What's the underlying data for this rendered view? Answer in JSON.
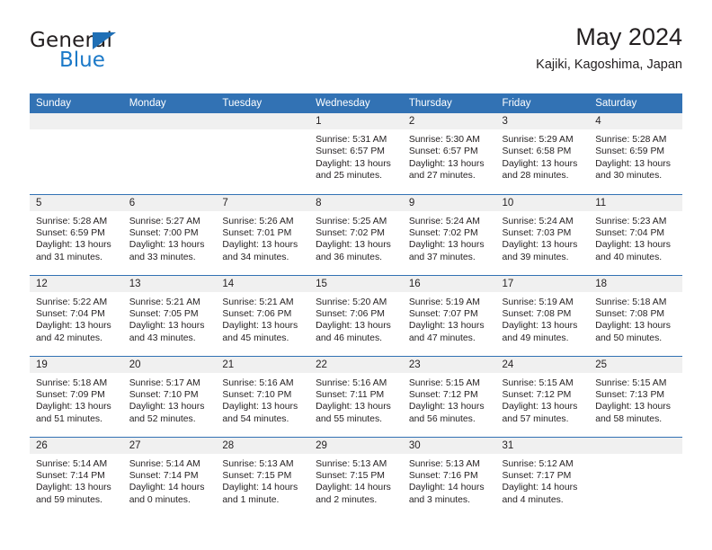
{
  "brand": {
    "name_top": "General",
    "name_bottom": "Blue",
    "accent_color": "#1b79c8",
    "header_color": "#3272b4"
  },
  "header": {
    "title": "May 2024",
    "subtitle": "Kajiki, Kagoshima, Japan"
  },
  "weekday_headers": [
    "Sunday",
    "Monday",
    "Tuesday",
    "Wednesday",
    "Thursday",
    "Friday",
    "Saturday"
  ],
  "weeks": [
    [
      {
        "day": "",
        "empty": true
      },
      {
        "day": "",
        "empty": true
      },
      {
        "day": "",
        "empty": true
      },
      {
        "day": "1",
        "sunrise": "Sunrise: 5:31 AM",
        "sunset": "Sunset: 6:57 PM",
        "daylight_line1": "Daylight: 13 hours",
        "daylight_line2": "and 25 minutes."
      },
      {
        "day": "2",
        "sunrise": "Sunrise: 5:30 AM",
        "sunset": "Sunset: 6:57 PM",
        "daylight_line1": "Daylight: 13 hours",
        "daylight_line2": "and 27 minutes."
      },
      {
        "day": "3",
        "sunrise": "Sunrise: 5:29 AM",
        "sunset": "Sunset: 6:58 PM",
        "daylight_line1": "Daylight: 13 hours",
        "daylight_line2": "and 28 minutes."
      },
      {
        "day": "4",
        "sunrise": "Sunrise: 5:28 AM",
        "sunset": "Sunset: 6:59 PM",
        "daylight_line1": "Daylight: 13 hours",
        "daylight_line2": "and 30 minutes."
      }
    ],
    [
      {
        "day": "5",
        "sunrise": "Sunrise: 5:28 AM",
        "sunset": "Sunset: 6:59 PM",
        "daylight_line1": "Daylight: 13 hours",
        "daylight_line2": "and 31 minutes."
      },
      {
        "day": "6",
        "sunrise": "Sunrise: 5:27 AM",
        "sunset": "Sunset: 7:00 PM",
        "daylight_line1": "Daylight: 13 hours",
        "daylight_line2": "and 33 minutes."
      },
      {
        "day": "7",
        "sunrise": "Sunrise: 5:26 AM",
        "sunset": "Sunset: 7:01 PM",
        "daylight_line1": "Daylight: 13 hours",
        "daylight_line2": "and 34 minutes."
      },
      {
        "day": "8",
        "sunrise": "Sunrise: 5:25 AM",
        "sunset": "Sunset: 7:02 PM",
        "daylight_line1": "Daylight: 13 hours",
        "daylight_line2": "and 36 minutes."
      },
      {
        "day": "9",
        "sunrise": "Sunrise: 5:24 AM",
        "sunset": "Sunset: 7:02 PM",
        "daylight_line1": "Daylight: 13 hours",
        "daylight_line2": "and 37 minutes."
      },
      {
        "day": "10",
        "sunrise": "Sunrise: 5:24 AM",
        "sunset": "Sunset: 7:03 PM",
        "daylight_line1": "Daylight: 13 hours",
        "daylight_line2": "and 39 minutes."
      },
      {
        "day": "11",
        "sunrise": "Sunrise: 5:23 AM",
        "sunset": "Sunset: 7:04 PM",
        "daylight_line1": "Daylight: 13 hours",
        "daylight_line2": "and 40 minutes."
      }
    ],
    [
      {
        "day": "12",
        "sunrise": "Sunrise: 5:22 AM",
        "sunset": "Sunset: 7:04 PM",
        "daylight_line1": "Daylight: 13 hours",
        "daylight_line2": "and 42 minutes."
      },
      {
        "day": "13",
        "sunrise": "Sunrise: 5:21 AM",
        "sunset": "Sunset: 7:05 PM",
        "daylight_line1": "Daylight: 13 hours",
        "daylight_line2": "and 43 minutes."
      },
      {
        "day": "14",
        "sunrise": "Sunrise: 5:21 AM",
        "sunset": "Sunset: 7:06 PM",
        "daylight_line1": "Daylight: 13 hours",
        "daylight_line2": "and 45 minutes."
      },
      {
        "day": "15",
        "sunrise": "Sunrise: 5:20 AM",
        "sunset": "Sunset: 7:06 PM",
        "daylight_line1": "Daylight: 13 hours",
        "daylight_line2": "and 46 minutes."
      },
      {
        "day": "16",
        "sunrise": "Sunrise: 5:19 AM",
        "sunset": "Sunset: 7:07 PM",
        "daylight_line1": "Daylight: 13 hours",
        "daylight_line2": "and 47 minutes."
      },
      {
        "day": "17",
        "sunrise": "Sunrise: 5:19 AM",
        "sunset": "Sunset: 7:08 PM",
        "daylight_line1": "Daylight: 13 hours",
        "daylight_line2": "and 49 minutes."
      },
      {
        "day": "18",
        "sunrise": "Sunrise: 5:18 AM",
        "sunset": "Sunset: 7:08 PM",
        "daylight_line1": "Daylight: 13 hours",
        "daylight_line2": "and 50 minutes."
      }
    ],
    [
      {
        "day": "19",
        "sunrise": "Sunrise: 5:18 AM",
        "sunset": "Sunset: 7:09 PM",
        "daylight_line1": "Daylight: 13 hours",
        "daylight_line2": "and 51 minutes."
      },
      {
        "day": "20",
        "sunrise": "Sunrise: 5:17 AM",
        "sunset": "Sunset: 7:10 PM",
        "daylight_line1": "Daylight: 13 hours",
        "daylight_line2": "and 52 minutes."
      },
      {
        "day": "21",
        "sunrise": "Sunrise: 5:16 AM",
        "sunset": "Sunset: 7:10 PM",
        "daylight_line1": "Daylight: 13 hours",
        "daylight_line2": "and 54 minutes."
      },
      {
        "day": "22",
        "sunrise": "Sunrise: 5:16 AM",
        "sunset": "Sunset: 7:11 PM",
        "daylight_line1": "Daylight: 13 hours",
        "daylight_line2": "and 55 minutes."
      },
      {
        "day": "23",
        "sunrise": "Sunrise: 5:15 AM",
        "sunset": "Sunset: 7:12 PM",
        "daylight_line1": "Daylight: 13 hours",
        "daylight_line2": "and 56 minutes."
      },
      {
        "day": "24",
        "sunrise": "Sunrise: 5:15 AM",
        "sunset": "Sunset: 7:12 PM",
        "daylight_line1": "Daylight: 13 hours",
        "daylight_line2": "and 57 minutes."
      },
      {
        "day": "25",
        "sunrise": "Sunrise: 5:15 AM",
        "sunset": "Sunset: 7:13 PM",
        "daylight_line1": "Daylight: 13 hours",
        "daylight_line2": "and 58 minutes."
      }
    ],
    [
      {
        "day": "26",
        "sunrise": "Sunrise: 5:14 AM",
        "sunset": "Sunset: 7:14 PM",
        "daylight_line1": "Daylight: 13 hours",
        "daylight_line2": "and 59 minutes."
      },
      {
        "day": "27",
        "sunrise": "Sunrise: 5:14 AM",
        "sunset": "Sunset: 7:14 PM",
        "daylight_line1": "Daylight: 14 hours",
        "daylight_line2": "and 0 minutes."
      },
      {
        "day": "28",
        "sunrise": "Sunrise: 5:13 AM",
        "sunset": "Sunset: 7:15 PM",
        "daylight_line1": "Daylight: 14 hours",
        "daylight_line2": "and 1 minute."
      },
      {
        "day": "29",
        "sunrise": "Sunrise: 5:13 AM",
        "sunset": "Sunset: 7:15 PM",
        "daylight_line1": "Daylight: 14 hours",
        "daylight_line2": "and 2 minutes."
      },
      {
        "day": "30",
        "sunrise": "Sunrise: 5:13 AM",
        "sunset": "Sunset: 7:16 PM",
        "daylight_line1": "Daylight: 14 hours",
        "daylight_line2": "and 3 minutes."
      },
      {
        "day": "31",
        "sunrise": "Sunrise: 5:12 AM",
        "sunset": "Sunset: 7:17 PM",
        "daylight_line1": "Daylight: 14 hours",
        "daylight_line2": "and 4 minutes."
      },
      {
        "day": "",
        "empty": true
      }
    ]
  ]
}
